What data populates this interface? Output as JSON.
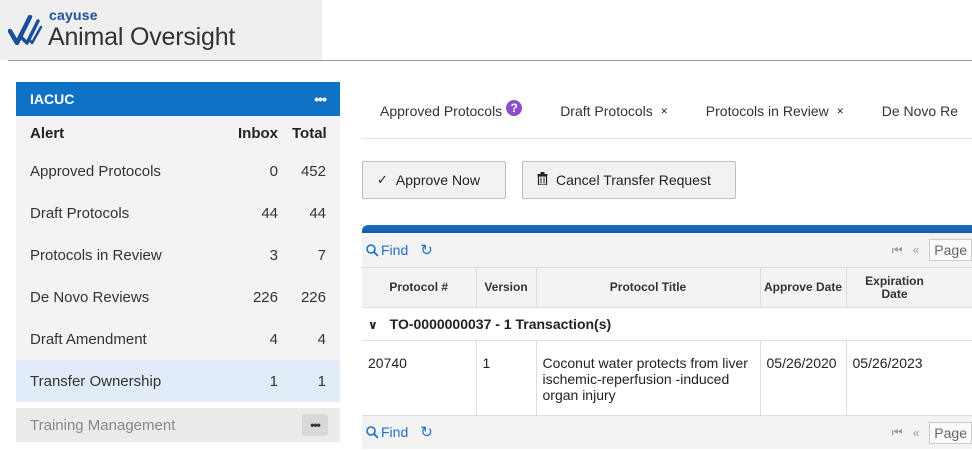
{
  "logo": {
    "brand_small": "cayuse",
    "brand_name": "Animal Oversight"
  },
  "sidebar": {
    "header_label": "IACUC",
    "header_menu": "•••",
    "columns": {
      "alert": "Alert",
      "inbox": "Inbox",
      "total": "Total"
    },
    "items": [
      {
        "label": "Approved Protocols",
        "inbox": "0",
        "total": "452"
      },
      {
        "label": "Draft Protocols",
        "inbox": "44",
        "total": "44"
      },
      {
        "label": "Protocols in Review",
        "inbox": "3",
        "total": "7"
      },
      {
        "label": "De Novo Reviews",
        "inbox": "226",
        "total": "226"
      },
      {
        "label": "Draft Amendment",
        "inbox": "4",
        "total": "4"
      },
      {
        "label": "Transfer Ownership",
        "inbox": "1",
        "total": "1"
      }
    ],
    "footer_label": "Training Management",
    "footer_menu": "•••"
  },
  "tabs": [
    {
      "label": "Approved Protocols",
      "help": "?"
    },
    {
      "label": "Draft Protocols",
      "close": "×"
    },
    {
      "label": "Protocols in Review",
      "close": "×"
    },
    {
      "label": "De Novo Re"
    }
  ],
  "actions": {
    "approve_now": "Approve Now",
    "approve_icon": "✓",
    "cancel_transfer": "Cancel Transfer Request",
    "cancel_icon": "🗑"
  },
  "grid": {
    "find_label": "Find",
    "refresh_icon": "↻",
    "pager": {
      "first": "⏮",
      "prev": "«",
      "page_label": "Page"
    },
    "columns": [
      "Protocol #",
      "Version",
      "Protocol Title",
      "Approve Date",
      "Expiration Date"
    ],
    "group": {
      "label": "TO-0000000037 - 1 Transaction(s)",
      "chevron": "⌄"
    },
    "rows": [
      {
        "protocol_no": "20740",
        "version": "1",
        "title": "Coconut water protects from liver ischemic-reperfusion -induced organ injury",
        "approve_date": "05/26/2020",
        "expiration_date": "05/26/2023"
      }
    ]
  },
  "colors": {
    "accent": "#0f72c4",
    "active_row": "#e2ecf8",
    "help_badge": "#8a4fc8",
    "link": "#1f6fc8"
  }
}
